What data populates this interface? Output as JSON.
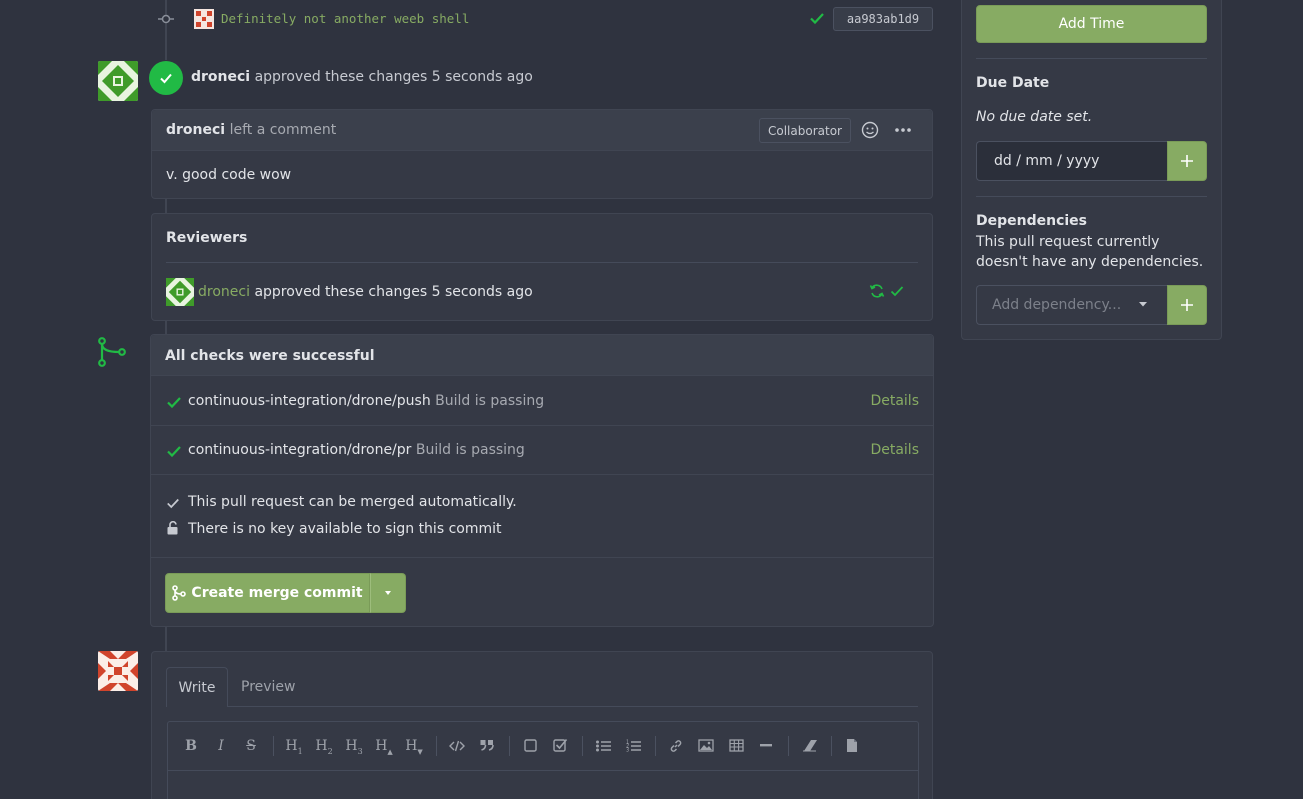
{
  "commit": {
    "message": "Definitely not another weeb shell",
    "sha": "aa983ab1d9"
  },
  "review_event": {
    "user": "droneci",
    "action": "approved these changes 5 seconds ago"
  },
  "comment": {
    "user": "droneci",
    "action": "left a comment",
    "role_badge": "Collaborator",
    "body": "v. good code wow"
  },
  "reviewers": {
    "heading": "Reviewers",
    "user": "droneci",
    "action": "approved these changes 5 seconds ago"
  },
  "checks": {
    "heading": "All checks were successful",
    "items": [
      {
        "context": "continuous-integration/drone/push",
        "status": "Build is passing",
        "link": "Details"
      },
      {
        "context": "continuous-integration/drone/pr",
        "status": "Build is passing",
        "link": "Details"
      }
    ],
    "mergeable_text": "This pull request can be merged automatically.",
    "signing_text": "There is no key available to sign this commit",
    "merge_button": "Create merge commit"
  },
  "editor": {
    "tabs": [
      "Write",
      "Preview"
    ],
    "toolbar": [
      "B",
      "I",
      "S",
      "H",
      "H",
      "H",
      "H",
      "H"
    ]
  },
  "sidebar": {
    "add_time_button": "Add Time",
    "due_date": {
      "heading": "Due Date",
      "empty_text": "No due date set.",
      "input_placeholder": "dd / mm / yyyy"
    },
    "dependencies": {
      "heading": "Dependencies",
      "empty_text": "This pull request currently doesn't have any dependencies.",
      "input_placeholder": "Add dependency..."
    }
  },
  "colors": {
    "background": "#2f333f",
    "panel": "#353945",
    "accent_green": "#87ab63",
    "success_green": "#21ba45"
  }
}
